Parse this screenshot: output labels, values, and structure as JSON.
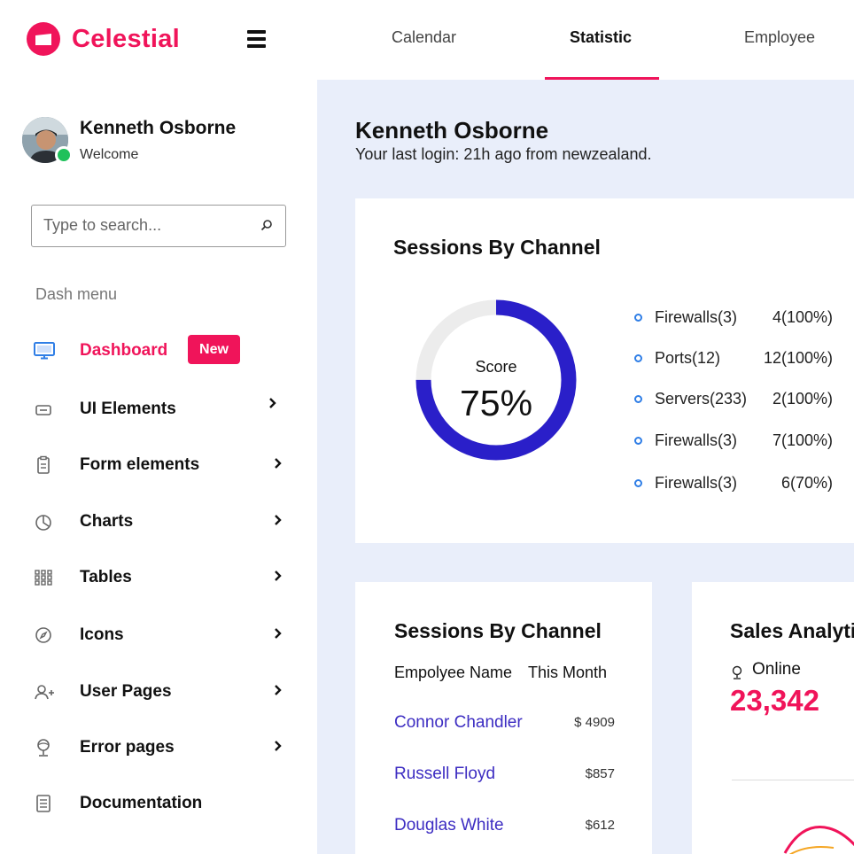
{
  "brand": {
    "name": "Celestial",
    "color": "#f0145a"
  },
  "top_nav": {
    "tabs": [
      {
        "label": "Calendar",
        "active": false
      },
      {
        "label": "Statistic",
        "active": true
      },
      {
        "label": "Employee",
        "active": false
      }
    ]
  },
  "sidebar": {
    "user": {
      "name": "Kenneth Osborne",
      "subtitle": "Welcome",
      "status": "online"
    },
    "search": {
      "placeholder": "Type to search...",
      "value": ""
    },
    "menu_heading": "Dash menu",
    "items": [
      {
        "label": "Dashboard",
        "icon": "monitor-icon",
        "badge": "New",
        "active": true
      },
      {
        "label": "UI Elements",
        "icon": "box-icon",
        "has_submenu": true
      },
      {
        "label": "Form elements",
        "icon": "clipboard-icon",
        "has_submenu": true
      },
      {
        "label": "Charts",
        "icon": "pie-chart-icon",
        "has_submenu": true
      },
      {
        "label": "Tables",
        "icon": "grid-icon",
        "has_submenu": true
      },
      {
        "label": "Icons",
        "icon": "compass-icon",
        "has_submenu": true
      },
      {
        "label": "User Pages",
        "icon": "user-add-icon",
        "has_submenu": true
      },
      {
        "label": "Error pages",
        "icon": "globe-icon",
        "has_submenu": true
      },
      {
        "label": "Documentation",
        "icon": "document-icon"
      }
    ]
  },
  "main": {
    "greeting_name": "Kenneth Osborne",
    "last_login": "Your last login: 21h ago from newzealand.",
    "sessions_card": {
      "title": "Sessions By Channel",
      "score_label": "Score",
      "score_value": "75%",
      "score_fraction": 0.75,
      "ring_color": "#2a1fc9",
      "track_color": "#ececec",
      "legend": [
        {
          "name": "Firewalls(3)",
          "value": "4(100%)"
        },
        {
          "name": "Ports(12)",
          "value": "12(100%)"
        },
        {
          "name": "Servers(233)",
          "value": "2(100%)"
        },
        {
          "name": "Firewalls(3)",
          "value": "7(100%)"
        },
        {
          "name": "Firewalls(3)",
          "value": "6(70%)"
        }
      ]
    },
    "employee_card": {
      "title": "Sessions By Channel",
      "col_name": "Empolyee Name",
      "col_month": "This Month",
      "rows": [
        {
          "name": "Connor Chandler",
          "amount": "$ 4909"
        },
        {
          "name": "Russell Floyd",
          "amount": "$857"
        },
        {
          "name": "Douglas White",
          "amount": "$612"
        }
      ]
    },
    "sales_card": {
      "title": "Sales Analytics",
      "online_label": "Online",
      "online_value": "23,342"
    }
  }
}
